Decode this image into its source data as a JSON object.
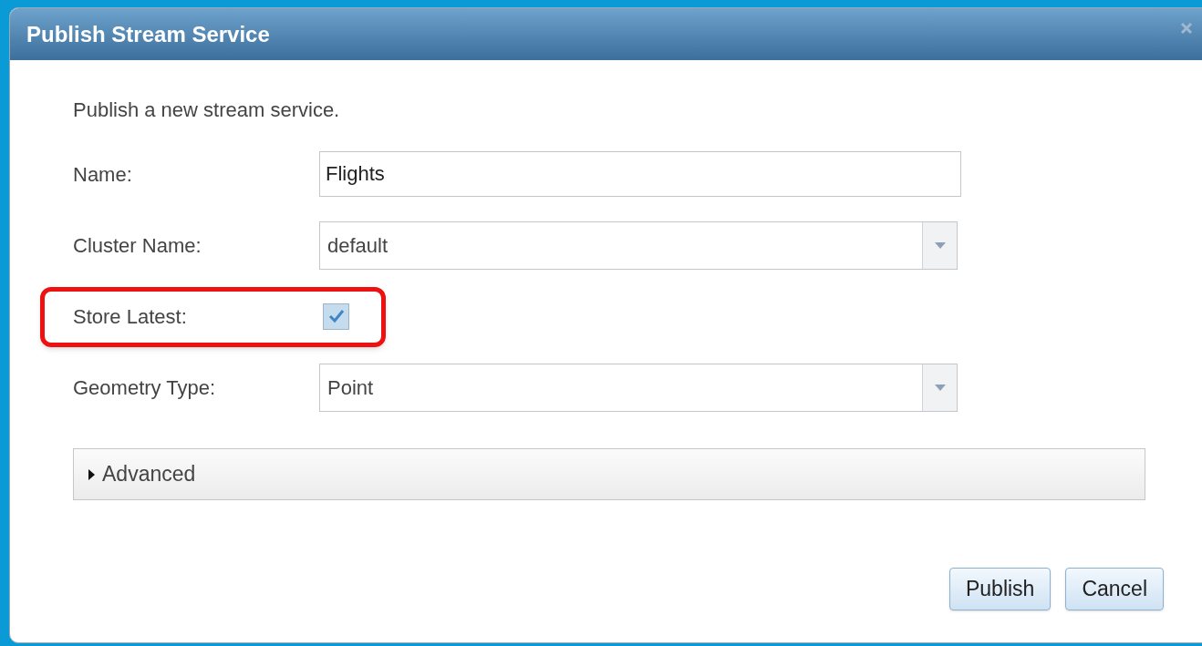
{
  "dialog": {
    "title": "Publish Stream Service"
  },
  "description": "Publish a new stream service.",
  "fields": [
    {
      "kind": "text",
      "label": "Name:",
      "value": "Flights"
    },
    {
      "kind": "select",
      "label": "Cluster Name:",
      "value": "default"
    },
    {
      "kind": "checkbox",
      "label": "Store Latest:",
      "checked": true,
      "highlighted": true
    },
    {
      "kind": "select",
      "label": "Geometry Type:",
      "value": "Point"
    }
  ],
  "advanced": {
    "label": "Advanced",
    "expanded": false
  },
  "buttons": [
    "Publish",
    "Cancel"
  ]
}
